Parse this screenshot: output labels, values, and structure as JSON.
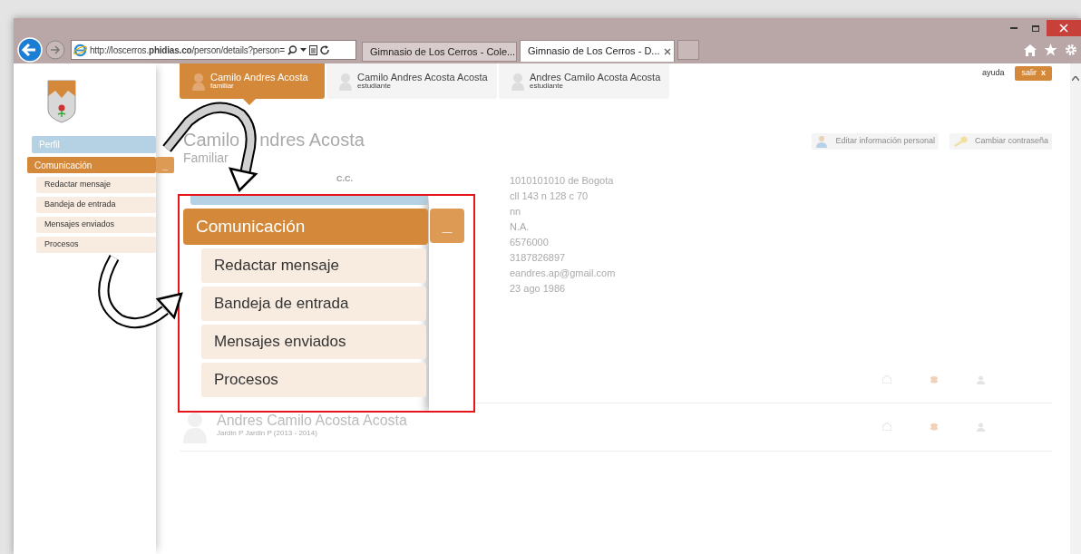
{
  "browser": {
    "address": "http://loscerros.**phidias.co**/person/details?person=",
    "tabs": [
      {
        "title": "Gimnasio de Los Cerros - Cole...",
        "selected": false
      },
      {
        "title": "Gimnasio de Los Cerros - D...",
        "selected": true
      }
    ]
  },
  "profiles": [
    {
      "name": "Camilo Andres Acosta",
      "role": "familiar",
      "selected": true
    },
    {
      "name": "Camilo Andres Acosta Acosta",
      "role": "estudiante",
      "selected": false
    },
    {
      "name": "Andres Camilo Acosta Acosta",
      "role": "estudiante",
      "selected": false
    }
  ],
  "top_links": {
    "help": "ayuda",
    "logout": "salir",
    "logout_icon": "x"
  },
  "sidebar": {
    "items": [
      {
        "label": "Perfil",
        "selected": false
      },
      {
        "label": "Comunicación",
        "selected": true,
        "toggle": "_",
        "children": [
          {
            "label": "Redactar mensaje"
          },
          {
            "label": "Bandeja de entrada"
          },
          {
            "label": "Mensajes enviados"
          },
          {
            "label": "Procesos"
          }
        ]
      }
    ]
  },
  "person": {
    "name_parts": [
      "Camilo",
      "ndres Acosta"
    ],
    "role": "Familiar"
  },
  "actions": [
    "Editar información personal",
    "Cambiar contraseña"
  ],
  "details": {
    "labels": [
      "C.C."
    ],
    "values": [
      "1010101010 de Bogota",
      "cll 143 n 128 c 70",
      "nn",
      "N.A.",
      "6576000",
      "3187826897",
      "eandres.ap@gmail.com",
      "23 ago 1986"
    ]
  },
  "students": [
    {
      "name": "Andres Camilo Acosta Acosta",
      "course": "Jardin P Jardin P (2013 - 2014)"
    }
  ],
  "callout": {
    "title": "Comunicación",
    "toggle": "_",
    "items": [
      "Redactar mensaje",
      "Bandeja de entrada",
      "Mensajes enviados",
      "Procesos"
    ]
  }
}
